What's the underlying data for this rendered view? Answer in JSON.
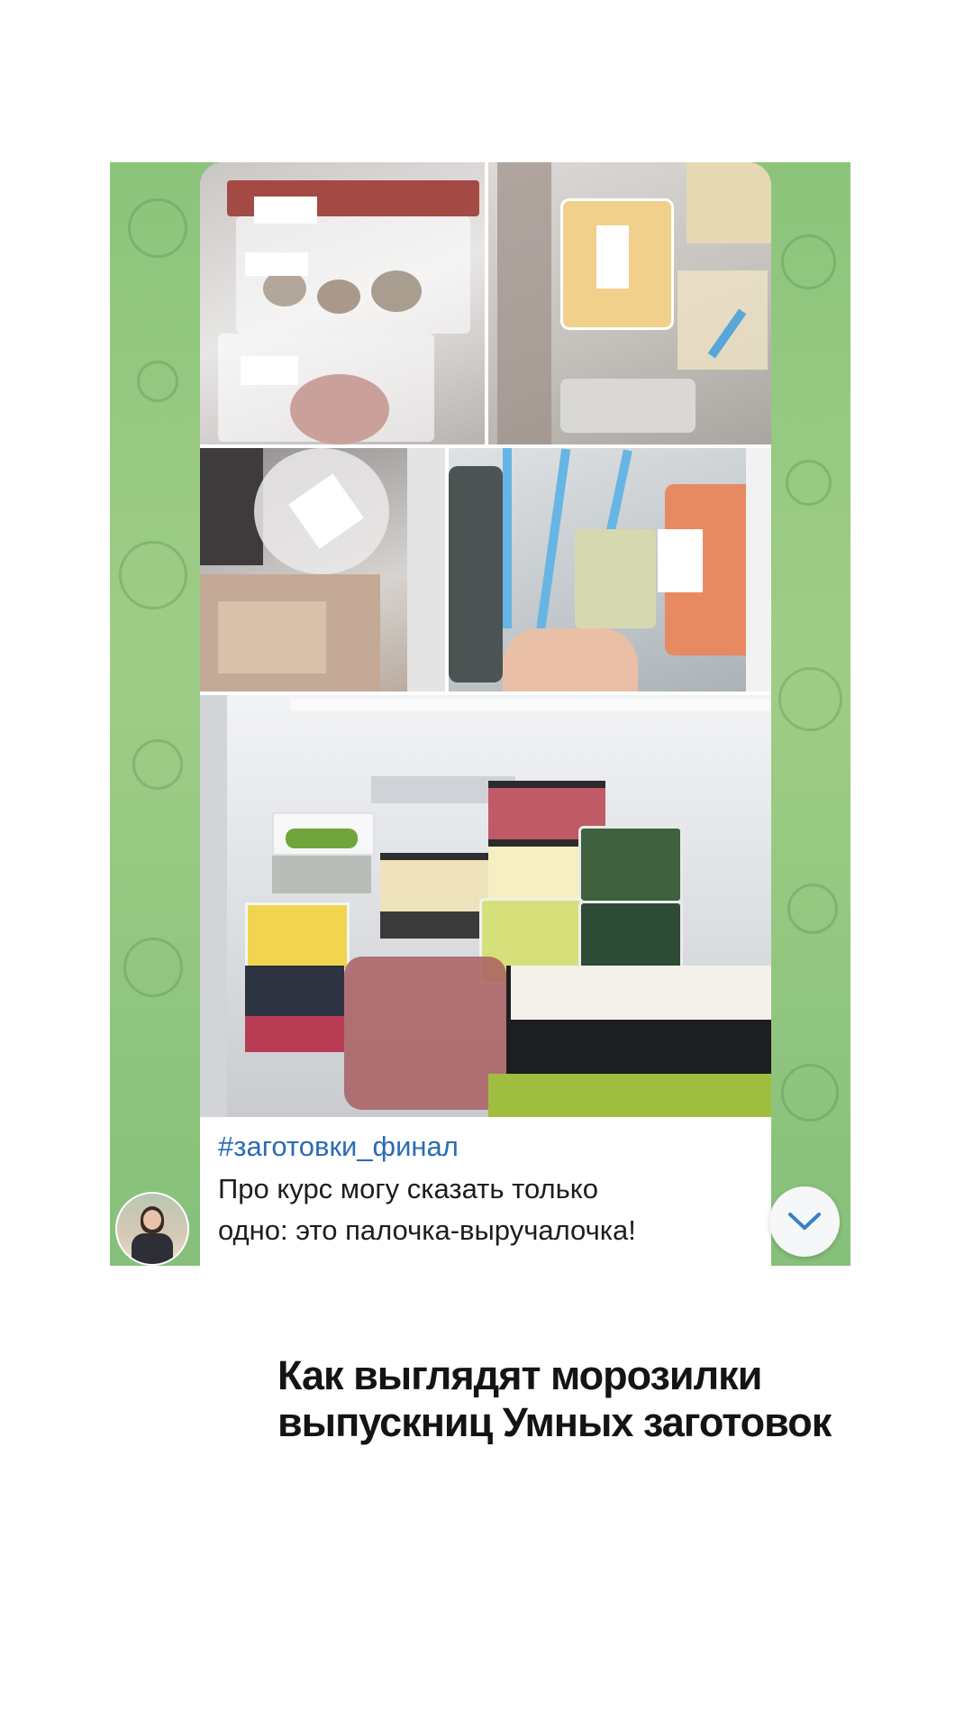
{
  "post": {
    "hashtag": "#заготовки_финал",
    "line1": "Про курс могу сказать только",
    "line2": "одно: это палочка-выручалочка!"
  },
  "headline": {
    "line1": "Как выглядят морозилки",
    "line2": "выпускниц Умных заготовок"
  },
  "colors": {
    "chat_background": "#8cc47b",
    "hashtag": "#2a6cb3",
    "scroll_arrow": "#3a7fc4"
  },
  "icons": {
    "scroll_down": "chevron-down-icon",
    "avatar": "user-avatar"
  }
}
